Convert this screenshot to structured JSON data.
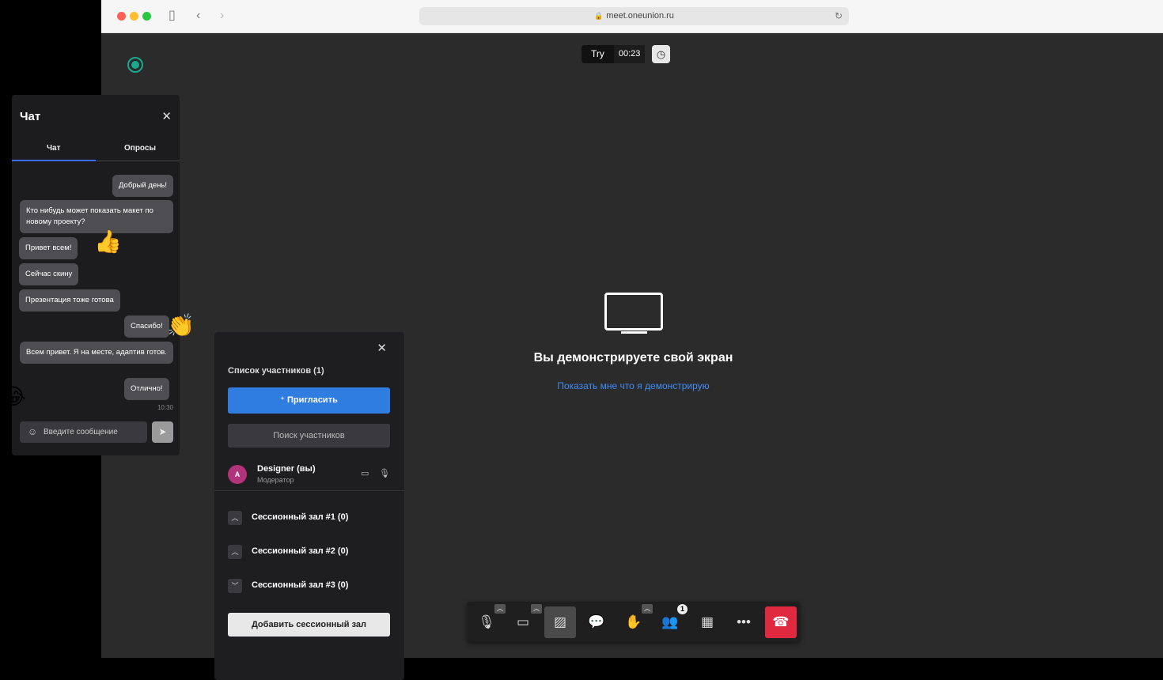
{
  "browser": {
    "url": "meet.oneunion.ru"
  },
  "meeting": {
    "timer_label": "Try",
    "timer_value": "00:23",
    "share_title": "Вы демонстрируете свой экран",
    "share_link": "Показать мне что я демонстрирую"
  },
  "chat": {
    "title": "Чат",
    "tabs": [
      "Чат",
      "Опросы"
    ],
    "messages": [
      "Добрый день!",
      "Кто нибудь может показать макет по новому проекту?",
      "Привет всем!",
      "Сейчас скину",
      "Презентация тоже готова",
      "Спасибо!",
      "Всем привет. Я на месте, адаптив готов.",
      "Отлично!"
    ],
    "last_time": "10:30",
    "input_placeholder": "Введите сообщение"
  },
  "participants": {
    "title": "Список участников (1)",
    "invite_label": "Пригласить",
    "search_label": "Поиск участников",
    "user": {
      "initial": "A",
      "name": "Designer (вы)",
      "role": "Модератор"
    },
    "rooms": [
      "Сессионный зал #1 (0)",
      "Сессионный зал #2 (0)",
      "Сессионный зал #3 (0)"
    ],
    "add_room_label": "Добавить сессионный зал"
  },
  "toolbar": {
    "participants_count": "1"
  },
  "colors": {
    "accent": "#2f7de1",
    "hangup": "#e0283e",
    "link": "#3f8cf5"
  }
}
